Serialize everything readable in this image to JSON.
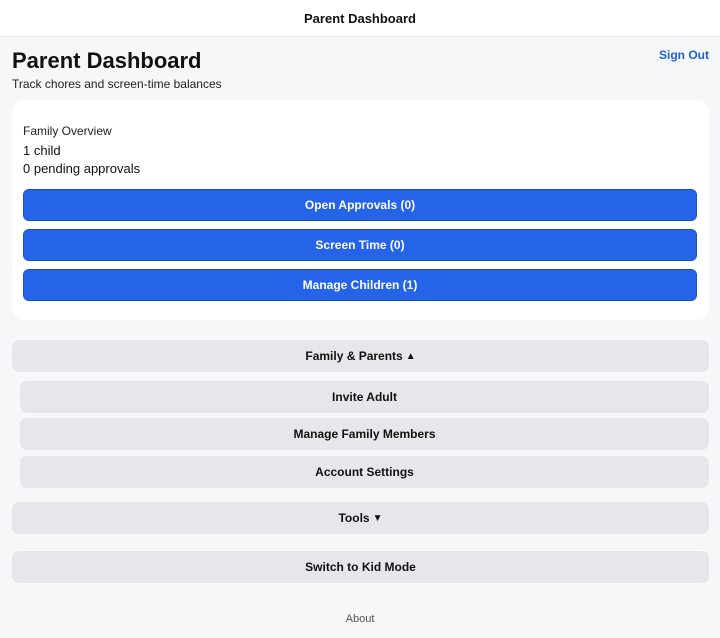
{
  "nav": {
    "title": "Parent Dashboard"
  },
  "header": {
    "title": "Parent Dashboard",
    "subtitle": "Track chores and screen-time balances",
    "sign_out": "Sign Out"
  },
  "overview": {
    "heading": "Family Overview",
    "children_count": "1 child",
    "pending": "0 pending approvals",
    "buttons": {
      "approvals": "Open Approvals (0)",
      "screen_time": "Screen Time (0)",
      "manage_children": "Manage Children (1)"
    }
  },
  "family_section": {
    "label": "Family & Parents",
    "arrow": "▲",
    "expanded": true,
    "items": [
      "Invite Adult",
      "Manage Family Members",
      "Account Settings"
    ]
  },
  "tools_section": {
    "label": "Tools",
    "arrow": "▼",
    "expanded": false
  },
  "kid_mode": "Switch to Kid Mode",
  "footer": {
    "about": "About"
  },
  "colors": {
    "accent": "#2563e8",
    "link": "#1f5fd1",
    "secondary_button": "#e6e7ea"
  }
}
